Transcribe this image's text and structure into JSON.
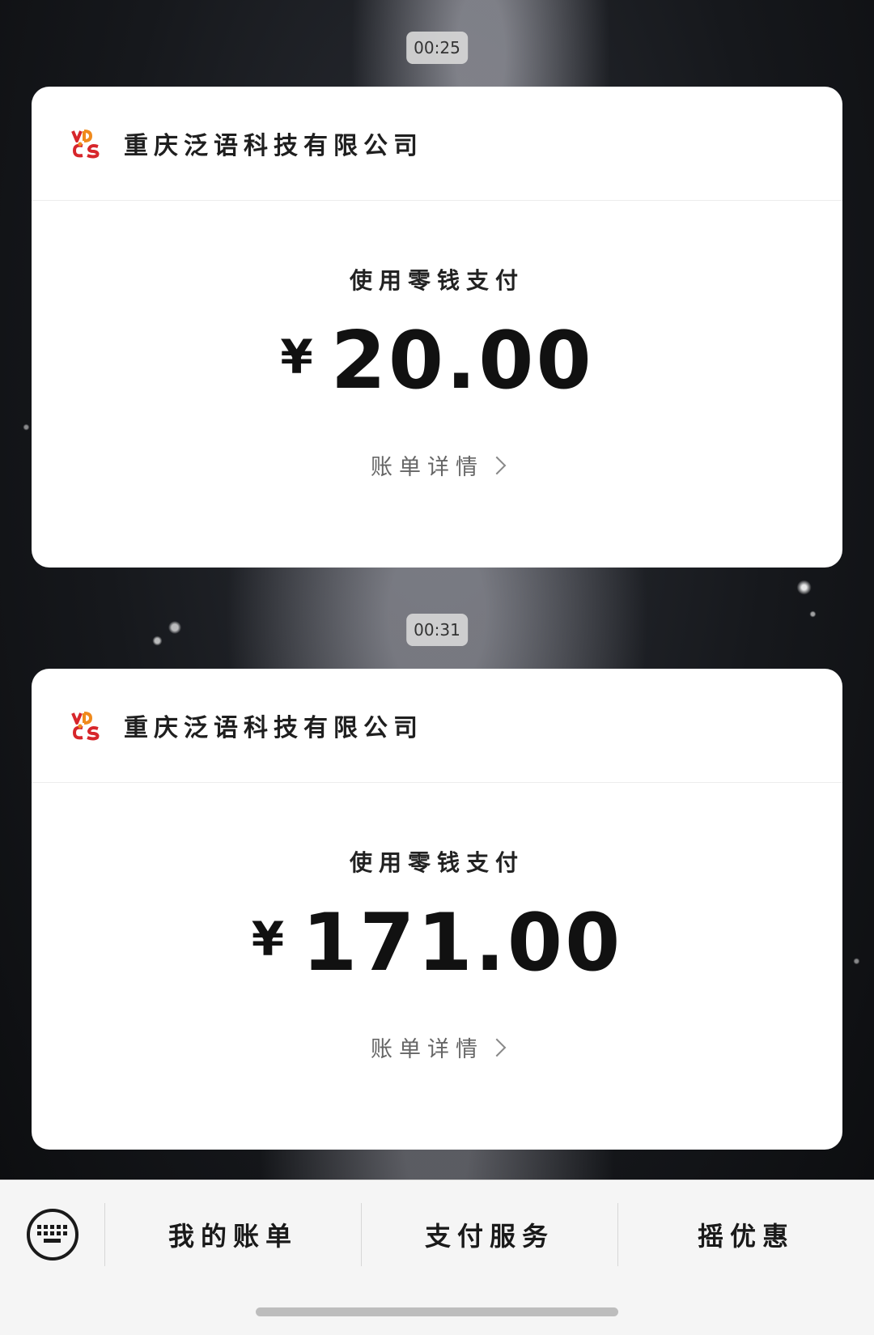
{
  "messages": [
    {
      "time": "00:25",
      "merchant": "重庆泛语科技有限公司",
      "pay_method": "使用零钱支付",
      "currency": "¥",
      "amount": "20.00",
      "detail_label": "账单详情"
    },
    {
      "time": "00:31",
      "merchant": "重庆泛语科技有限公司",
      "pay_method": "使用零钱支付",
      "currency": "¥",
      "amount": "171.00",
      "detail_label": "账单详情"
    }
  ],
  "menu": {
    "items": [
      "我的账单",
      "支付服务",
      "摇优惠"
    ],
    "keyboard_icon": "keyboard-icon"
  },
  "colors": {
    "card_bg": "#ffffff",
    "menu_bg": "#f5f5f5",
    "logo_red": "#d7262b",
    "logo_orange": "#f08a1c"
  }
}
